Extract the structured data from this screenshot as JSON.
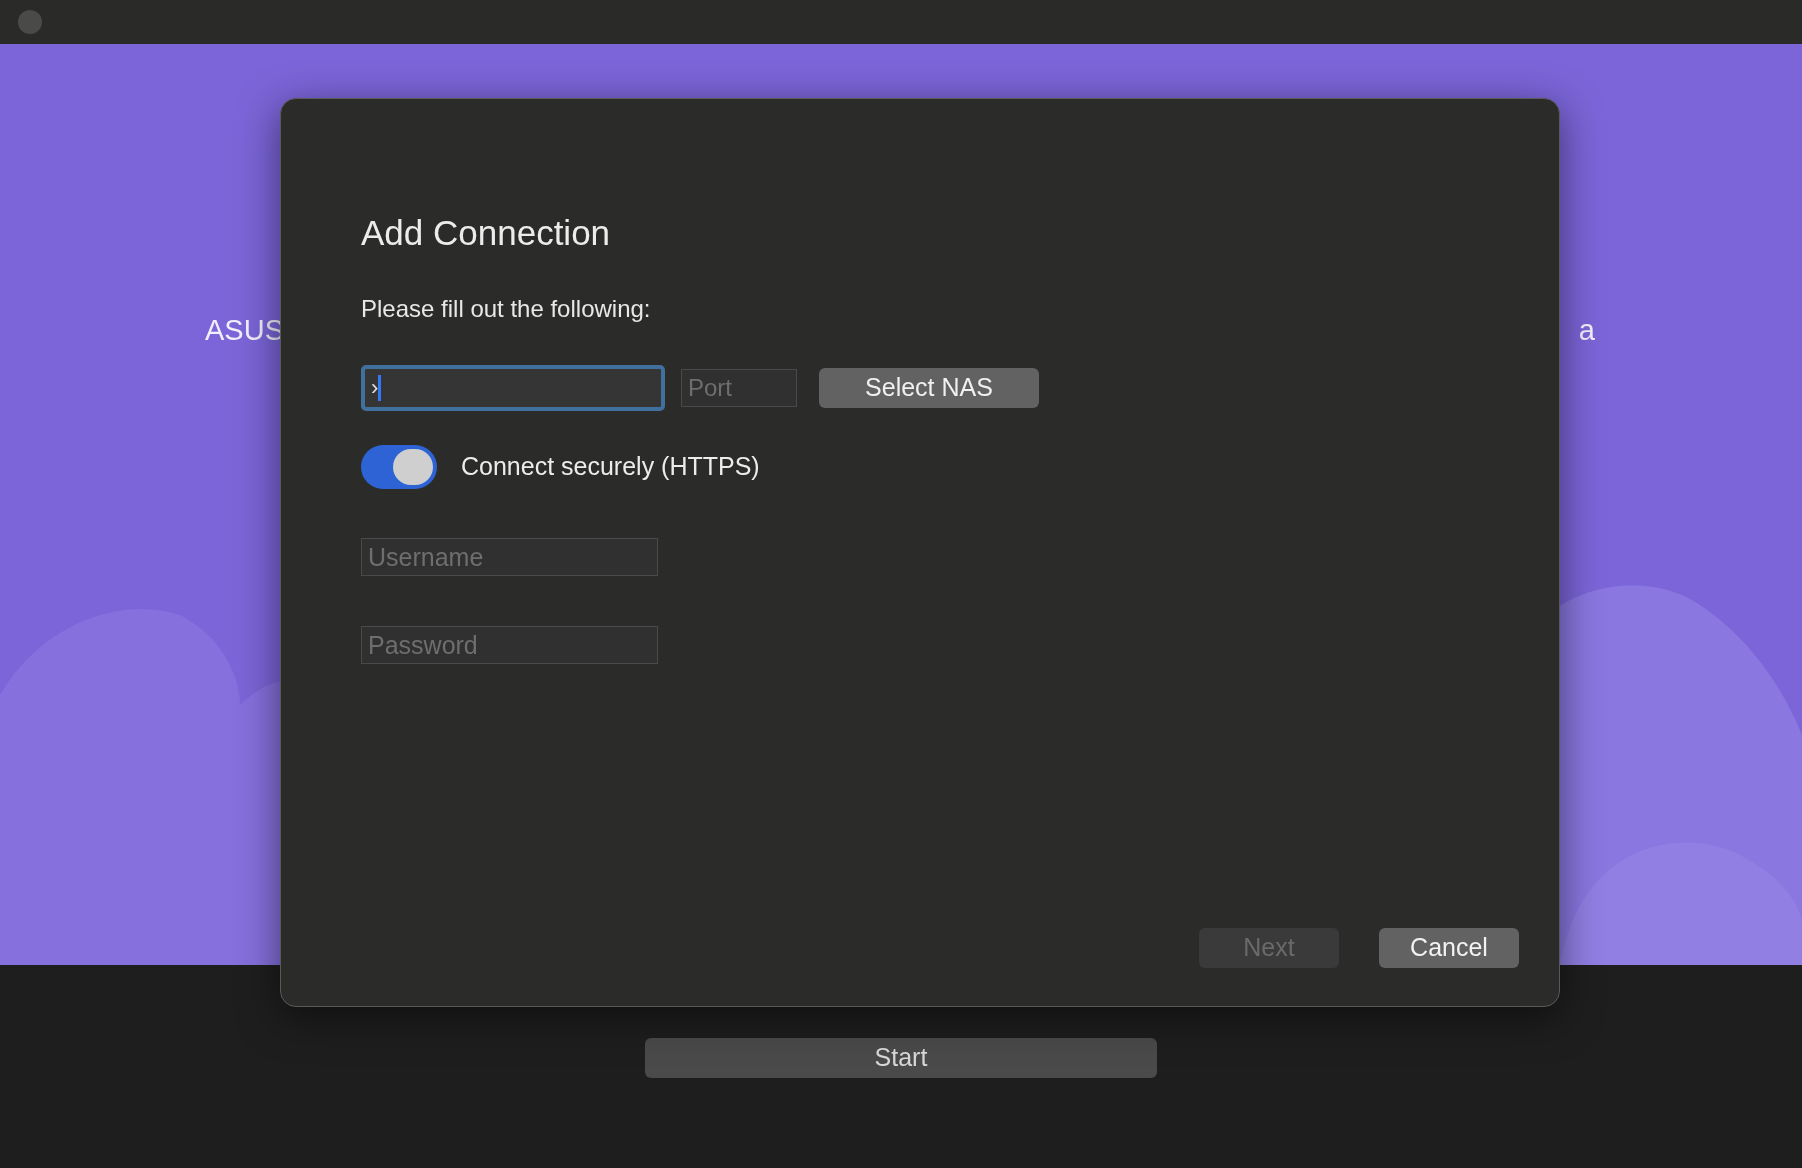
{
  "background": {
    "texts": [
      "ASUS",
      "a"
    ]
  },
  "dialog": {
    "title": "Add Connection",
    "instruction": "Please fill out the following:",
    "address": {
      "value": "›",
      "focused": true
    },
    "port": {
      "placeholder": "Port"
    },
    "select_button": "Select NAS",
    "secure_toggle": {
      "label": "Connect securely (HTTPS)",
      "on": true
    },
    "username": {
      "placeholder": "Username"
    },
    "password": {
      "placeholder": "Password"
    },
    "buttons": [
      {
        "label": "Next",
        "disabled": true
      },
      {
        "label": "Cancel",
        "disabled": false
      }
    ]
  },
  "start_button": "Start"
}
